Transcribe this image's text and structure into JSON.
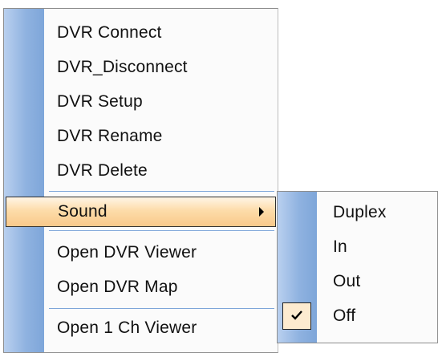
{
  "main_menu": {
    "items": [
      {
        "label": "DVR Connect"
      },
      {
        "label": "DVR_Disconnect"
      },
      {
        "label": "DVR Setup"
      },
      {
        "label": "DVR Rename"
      },
      {
        "label": "DVR Delete"
      },
      {
        "label": "Sound",
        "selected": true,
        "has_submenu": true
      },
      {
        "label": "Open DVR Viewer"
      },
      {
        "label": "Open DVR Map"
      },
      {
        "label": "Open 1 Ch Viewer"
      }
    ]
  },
  "sound_submenu": {
    "items": [
      {
        "label": "Duplex",
        "checked": false
      },
      {
        "label": "In",
        "checked": false
      },
      {
        "label": "Out",
        "checked": false
      },
      {
        "label": "Off",
        "checked": true
      }
    ]
  },
  "colors": {
    "icon_strip": "#8fb2e0",
    "highlight": "#fddcaa",
    "menu_background": "#fbfbfb"
  }
}
